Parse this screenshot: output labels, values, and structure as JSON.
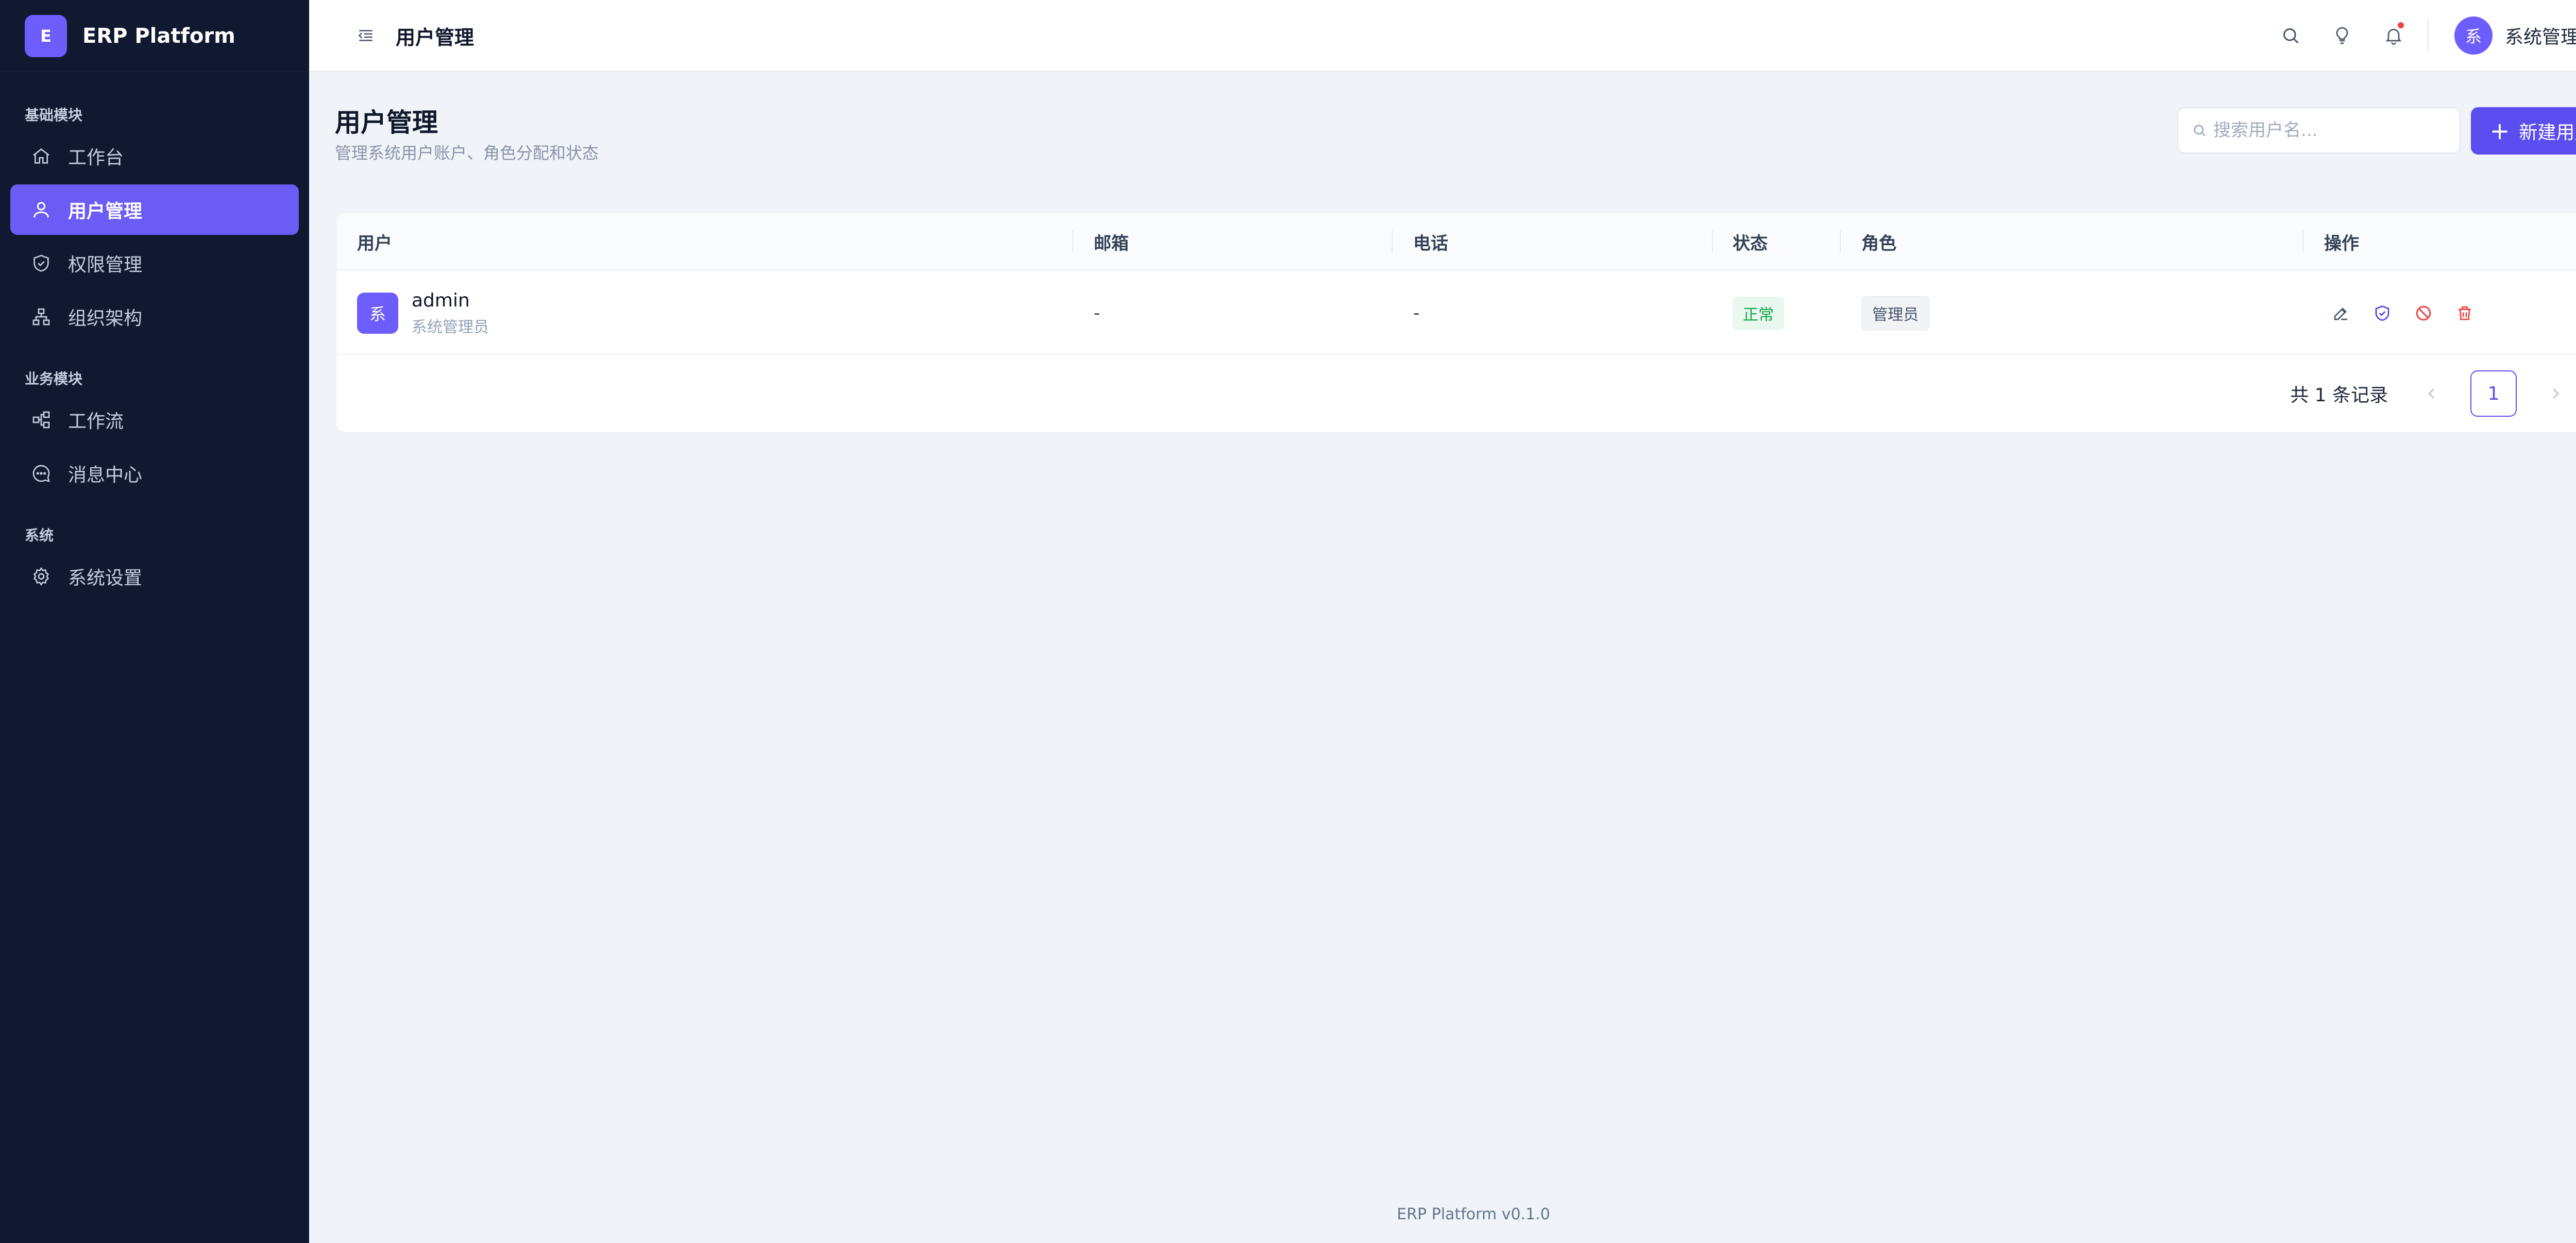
{
  "brand": {
    "logo_letter": "E",
    "name": "ERP Platform"
  },
  "sidebar": {
    "sections": [
      {
        "title": "基础模块",
        "items": [
          {
            "label": "工作台",
            "icon": "home-icon"
          },
          {
            "label": "用户管理",
            "icon": "user-icon",
            "active": true
          },
          {
            "label": "权限管理",
            "icon": "shield-icon"
          },
          {
            "label": "组织架构",
            "icon": "org-tree-icon"
          }
        ]
      },
      {
        "title": "业务模块",
        "items": [
          {
            "label": "工作流",
            "icon": "workflow-icon"
          },
          {
            "label": "消息中心",
            "icon": "message-icon"
          }
        ]
      },
      {
        "title": "系统",
        "items": [
          {
            "label": "系统设置",
            "icon": "gear-icon"
          }
        ]
      }
    ]
  },
  "topbar": {
    "title": "用户管理",
    "user": {
      "avatar_char": "系",
      "name": "系统管理员"
    }
  },
  "page": {
    "title": "用户管理",
    "subtitle": "管理系统用户账户、角色分配和状态",
    "search_placeholder": "搜索用户名...",
    "new_button_label": "新建用户"
  },
  "table": {
    "columns": [
      "用户",
      "邮箱",
      "电话",
      "状态",
      "角色",
      "操作"
    ],
    "rows": [
      {
        "avatar_char": "系",
        "username": "admin",
        "nickname": "系统管理员",
        "email": "-",
        "phone": "-",
        "status": "正常",
        "role": "管理员"
      }
    ]
  },
  "pagination": {
    "total_text": "共 1 条记录",
    "current_page": "1"
  },
  "footer": {
    "text": "ERP Platform v0.1.0"
  },
  "colors": {
    "accent": "#5b4df0",
    "sidebar_bg": "#111931",
    "status_ok": "#16a34a",
    "danger": "#ef4444"
  }
}
